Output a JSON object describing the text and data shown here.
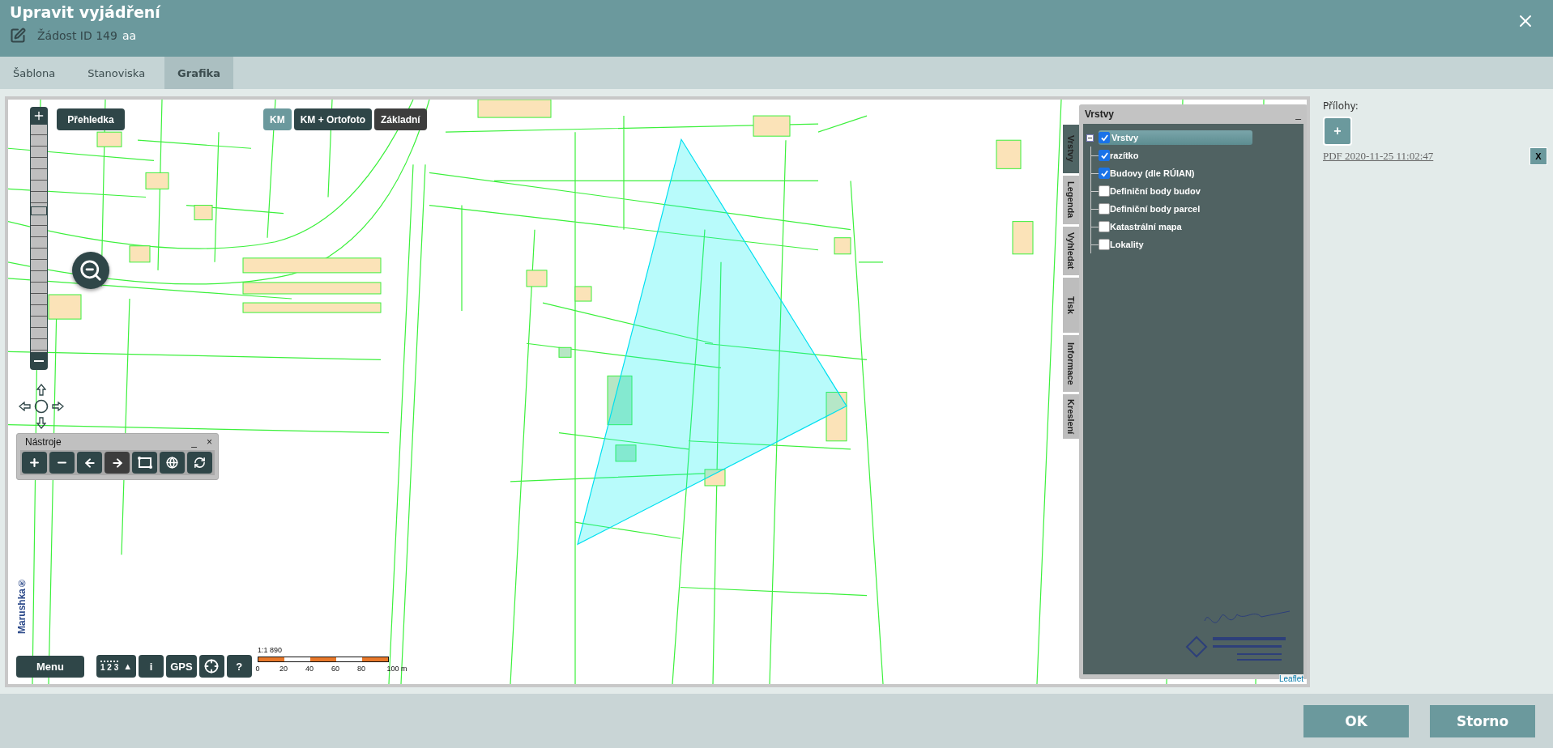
{
  "dialog": {
    "title": "Upravit vyjádření",
    "subtitle": "Žádost ID 149",
    "subtitle_note": "aa"
  },
  "tabs": [
    {
      "label": "Šablona",
      "selected": false
    },
    {
      "label": "Stanoviska",
      "selected": false
    },
    {
      "label": "Grafika",
      "selected": true
    }
  ],
  "map": {
    "overview_button": "Přehledka",
    "base_layers": [
      {
        "label": "KM",
        "selected": true
      },
      {
        "label": "KM + Ortofoto",
        "selected": false
      },
      {
        "label": "Základní",
        "selected": false
      }
    ],
    "zoom_slider": {
      "level": 0.62
    },
    "tools_panel": {
      "title": "Nástroje",
      "minimize": "_",
      "close": "×",
      "tools": [
        {
          "kind": "plus",
          "selected": false
        },
        {
          "kind": "minus",
          "selected": false
        },
        {
          "kind": "back",
          "selected": false
        },
        {
          "kind": "forward",
          "selected": true
        },
        {
          "kind": "extent",
          "selected": false
        },
        {
          "kind": "globe",
          "selected": false
        },
        {
          "kind": "refresh",
          "selected": false
        }
      ]
    },
    "logo": "Marushka®",
    "menu_button": "Menu",
    "bottom_tools": [
      {
        "kind": "ruler",
        "label": "1 2 3",
        "suffix": "▲"
      },
      {
        "kind": "text",
        "label": "i"
      },
      {
        "kind": "text",
        "label": "GPS"
      },
      {
        "kind": "crosshair"
      },
      {
        "kind": "text",
        "label": "?"
      }
    ],
    "scale": {
      "ratio": "1:1 890",
      "ticks": [
        "0",
        "20",
        "40",
        "60",
        "80",
        "100 m"
      ]
    },
    "layers_panel": {
      "title": "Vrstvy",
      "minimize": "_",
      "tabs": [
        {
          "label": "Vrstvy",
          "selected": true
        },
        {
          "label": "Legenda",
          "selected": false
        },
        {
          "label": "Vyhledat",
          "selected": false
        },
        {
          "label": "Tisk",
          "selected": false
        },
        {
          "label": "Informace",
          "selected": false
        },
        {
          "label": "Kreslení",
          "selected": false
        }
      ],
      "tree": {
        "label": "Vrstvy",
        "checked": true,
        "expanded": true,
        "selected": true,
        "children": [
          {
            "label": "razítko",
            "checked": true
          },
          {
            "label": "Budovy (dle RÚIAN)",
            "checked": true
          },
          {
            "label": "Definiční body budov",
            "checked": false
          },
          {
            "label": "Definiční body parcel",
            "checked": false
          },
          {
            "label": "Katastrální mapa",
            "checked": false
          },
          {
            "label": "Lokality",
            "checked": false
          }
        ]
      }
    },
    "attribution": "Leaflet"
  },
  "attachments": {
    "title": "Přílohy:",
    "add_button": "+",
    "files": [
      {
        "name": "PDF 2020-11-25 11:02:47",
        "remove": "X"
      }
    ]
  },
  "buttons": [
    "OK",
    "Storno"
  ]
}
